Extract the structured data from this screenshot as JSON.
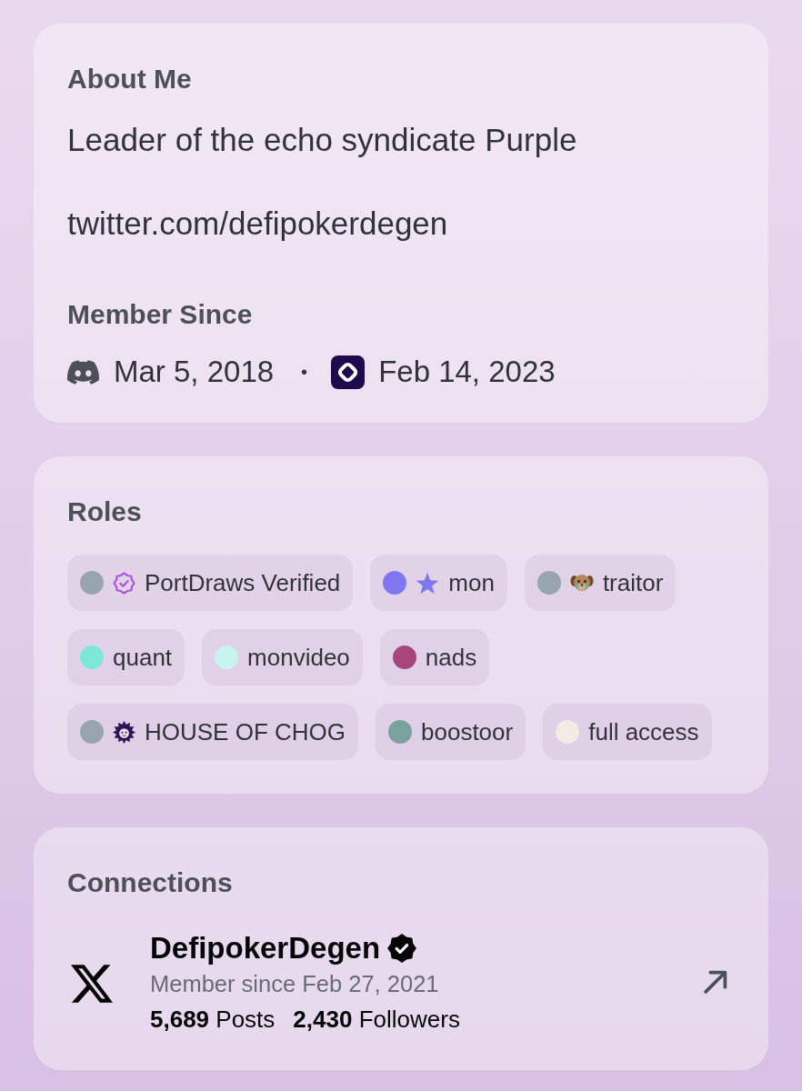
{
  "about_me": {
    "title": "About Me",
    "bio": [
      "Leader of the echo syndicate Purple",
      "twitter.com/defipokerdegen"
    ]
  },
  "member_since": {
    "title": "Member Since",
    "separator": "•",
    "entries": [
      {
        "kind": "discord",
        "date": "Mar 5, 2018"
      },
      {
        "kind": "server",
        "date": "Feb 14, 2023"
      }
    ]
  },
  "roles": {
    "title": "Roles",
    "items": [
      {
        "name": "PortDraws Verified",
        "color": "#99a5ae",
        "kind": "badge"
      },
      {
        "name": "mon",
        "color": "#8076f0",
        "kind": "star"
      },
      {
        "name": "traitor",
        "color": "#99a5ae",
        "kind": "puppy"
      },
      {
        "name": "quant",
        "color": "#7ee8d8",
        "kind": "plain"
      },
      {
        "name": "monvideo",
        "color": "#c9f3ef",
        "kind": "plain"
      },
      {
        "name": "nads",
        "color": "#a8457a",
        "kind": "plain"
      },
      {
        "name": "HOUSE OF CHOG",
        "color": "#99a5ae",
        "kind": "critter"
      },
      {
        "name": "boostoor",
        "color": "#7aa39e",
        "kind": "plain"
      },
      {
        "name": "full access",
        "color": "#f5ebe5",
        "kind": "plain"
      }
    ]
  },
  "connections": {
    "title": "Connections",
    "accounts": [
      {
        "kind": "x",
        "name": "DefipokerDegen",
        "verified": true,
        "member_since": "Member since Feb 27, 2021",
        "stats": [
          "**5,689** Posts",
          "**2,430** Followers"
        ]
      }
    ]
  }
}
